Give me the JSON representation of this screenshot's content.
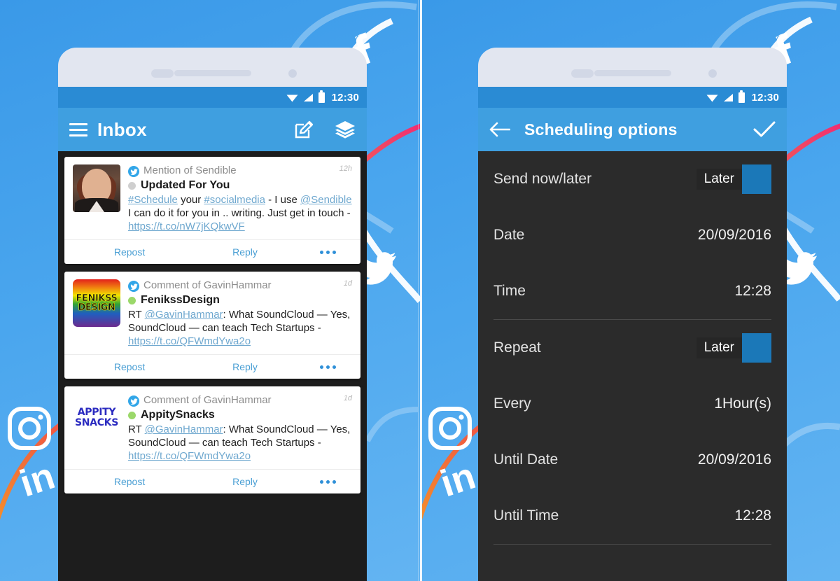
{
  "background": {
    "brand_blue": "#3f9fe0",
    "panel_gradient_from": "#3a99e8",
    "panel_gradient_to": "#63b4f2",
    "curve_pink": "#ef2e72",
    "curve_orange": "#f5a623",
    "decor_icons": [
      "facebook-icon",
      "twitter-icon",
      "instagram-icon",
      "linkedin-icon"
    ]
  },
  "left_phone": {
    "status_bar": {
      "time": "12:30",
      "icons": [
        "wifi-icon",
        "signal-icon",
        "battery-icon"
      ]
    },
    "app_bar": {
      "menu_icon": "hamburger-icon",
      "title": "Inbox",
      "compose_icon": "compose-icon",
      "layers_icon": "layers-icon"
    },
    "cards": [
      {
        "avatar": "photo-woman",
        "network": "twitter-icon",
        "meta": "Mention of Sendible",
        "age": "12h",
        "status_dot": "grey",
        "name": "Updated For You",
        "snippet_parts": [
          {
            "t": "#Schedule",
            "link": true
          },
          {
            "t": " your ",
            "link": false
          },
          {
            "t": "#socialmedia",
            "link": true
          },
          {
            "t": " - I use ",
            "link": false
          },
          {
            "t": "@Sendible",
            "link": true
          },
          {
            "t": " I can do it for you in .. writing. Just get in touch - ",
            "link": false
          },
          {
            "t": "https://t.co/nW7jKQkwVF",
            "link": true
          }
        ],
        "actions": {
          "repost": "Repost",
          "reply": "Reply",
          "more": "more-icon"
        }
      },
      {
        "avatar": "fenikss-logo",
        "avatar_text": [
          "FENIKSS",
          "DESIGN"
        ],
        "network": "twitter-icon",
        "meta": "Comment of GavinHammar",
        "age": "1d",
        "status_dot": "green",
        "name": "FenikssDesign",
        "snippet_parts": [
          {
            "t": "RT ",
            "link": false
          },
          {
            "t": "@GavinHammar",
            "link": true
          },
          {
            "t": ": What SoundCloud — Yes, SoundCloud — can teach Tech Startups - ",
            "link": false
          },
          {
            "t": "https://t.co/QFWmdYwa2o",
            "link": true
          }
        ],
        "actions": {
          "repost": "Repost",
          "reply": "Reply",
          "more": "more-icon"
        }
      },
      {
        "avatar": "appity-logo",
        "avatar_text": [
          "APPITY",
          "SNACKS"
        ],
        "network": "twitter-icon",
        "meta": "Comment of GavinHammar",
        "age": "1d",
        "status_dot": "green",
        "name": "AppitySnacks",
        "snippet_parts": [
          {
            "t": "RT ",
            "link": false
          },
          {
            "t": "@GavinHammar",
            "link": true
          },
          {
            "t": ": What SoundCloud — Yes, SoundCloud — can teach Tech Startups - ",
            "link": false
          },
          {
            "t": "https://t.co/QFWmdYwa2o",
            "link": true
          }
        ],
        "actions": {
          "repost": "Repost",
          "reply": "Reply",
          "more": "more-icon"
        }
      }
    ]
  },
  "right_phone": {
    "status_bar": {
      "time": "12:30",
      "icons": [
        "wifi-icon",
        "signal-icon",
        "battery-icon"
      ]
    },
    "app_bar": {
      "back_icon": "back-arrow-icon",
      "title": "Scheduling options",
      "confirm_icon": "check-icon"
    },
    "rows": [
      {
        "label": "Send now/later",
        "value": "Later",
        "type": "tooltip"
      },
      {
        "label": "Date",
        "value": "20/09/2016",
        "type": "text"
      },
      {
        "label": "Time",
        "value": "12:28",
        "type": "text"
      },
      {
        "label": "Repeat",
        "value": "Later",
        "type": "tooltip"
      },
      {
        "label": "Every",
        "value": "1Hour(s)",
        "type": "text"
      },
      {
        "label": "Until Date",
        "value": "20/09/2016",
        "type": "text"
      },
      {
        "label": "Until Time",
        "value": "12:28",
        "type": "text"
      }
    ]
  }
}
